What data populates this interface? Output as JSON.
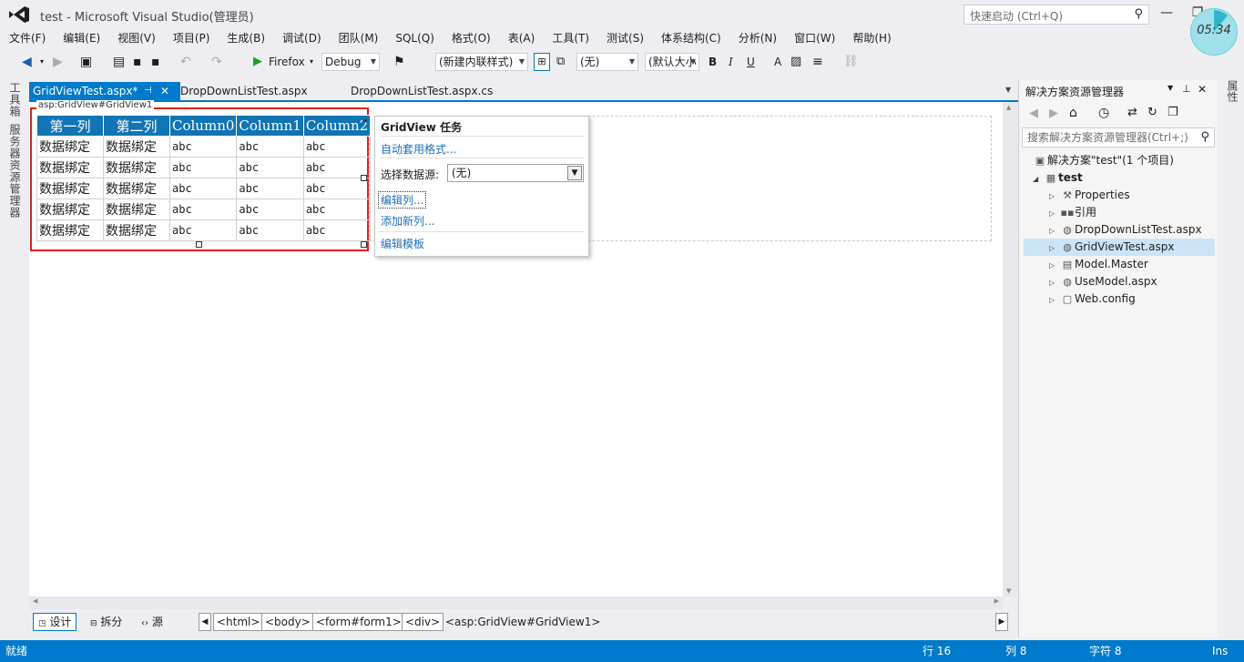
{
  "window": {
    "title": "test - Microsoft Visual Studio(管理员)",
    "quick_launch_placeholder": "快速启动 (Ctrl+Q)",
    "clock": "05:34"
  },
  "menu": [
    "文件(F)",
    "编辑(E)",
    "视图(V)",
    "项目(P)",
    "生成(B)",
    "调试(D)",
    "团队(M)",
    "SQL(Q)",
    "格式(O)",
    "表(A)",
    "工具(T)",
    "测试(S)",
    "体系结构(C)",
    "分析(N)",
    "窗口(W)",
    "帮助(H)"
  ],
  "toolbar": {
    "run_target": "Firefox",
    "config": "Debug",
    "style_combo": "(新建内联样式)",
    "element_combo": "(无)",
    "font_combo": "(默认大小",
    "bold": "B",
    "italic": "I",
    "underline": "U",
    "font_color": "A"
  },
  "left_tabs": [
    "工具箱",
    "服务器资源管理器"
  ],
  "doc_tabs": [
    {
      "label": "GridViewTest.aspx*",
      "active": true
    },
    {
      "label": "DropDownListTest.aspx",
      "active": false
    },
    {
      "label": "DropDownListTest.aspx.cs",
      "active": false
    }
  ],
  "designer": {
    "element_label": "asp:GridView#GridView1",
    "grid": {
      "headers": [
        "第一列",
        "第二列",
        "Column0",
        "Column1",
        "Column2"
      ],
      "rows": [
        [
          "数据绑定",
          "数据绑定",
          "abc",
          "abc",
          "abc"
        ],
        [
          "数据绑定",
          "数据绑定",
          "abc",
          "abc",
          "abc"
        ],
        [
          "数据绑定",
          "数据绑定",
          "abc",
          "abc",
          "abc"
        ],
        [
          "数据绑定",
          "数据绑定",
          "abc",
          "abc",
          "abc"
        ],
        [
          "数据绑定",
          "数据绑定",
          "abc",
          "abc",
          "abc"
        ]
      ]
    },
    "tasks": {
      "title": "GridView 任务",
      "auto_format": "自动套用格式...",
      "datasource_label": "选择数据源:",
      "datasource_value": "(无)",
      "edit_columns": "编辑列...",
      "add_column": "添加新列...",
      "edit_templates": "编辑模板"
    }
  },
  "viewbar": {
    "design": "设计",
    "split": "拆分",
    "source": "源",
    "tags": [
      "<html>",
      "<body>",
      "<form#form1>",
      "<div>"
    ],
    "current": "<asp:GridView#GridView1>"
  },
  "solution_explorer": {
    "title": "解决方案资源管理器",
    "search_placeholder": "搜索解决方案资源管理器(Ctrl+;)",
    "items": [
      {
        "label": "解决方案\"test\"(1 个项目)",
        "level": 0,
        "icon": "solution-icon",
        "glyph": "▣"
      },
      {
        "label": "test",
        "level": 1,
        "icon": "web-project-icon",
        "glyph": "▦",
        "bold": true
      },
      {
        "label": "Properties",
        "level": 2,
        "icon": "wrench-icon",
        "glyph": "🔧"
      },
      {
        "label": "引用",
        "level": 2,
        "icon": "references-icon",
        "glyph": "■"
      },
      {
        "label": "DropDownListTest.aspx",
        "level": 2,
        "icon": "aspx-file-icon",
        "glyph": "◍"
      },
      {
        "label": "GridViewTest.aspx",
        "level": 2,
        "icon": "aspx-file-icon",
        "glyph": "◍",
        "selected": true
      },
      {
        "label": "Model.Master",
        "level": 2,
        "icon": "master-file-icon",
        "glyph": "▤"
      },
      {
        "label": "UseModel.aspx",
        "level": 2,
        "icon": "aspx-file-icon",
        "glyph": "◍"
      },
      {
        "label": "Web.config",
        "level": 2,
        "icon": "config-file-icon",
        "glyph": "▢"
      }
    ]
  },
  "right_tab": "属性",
  "status": {
    "ready": "就绪",
    "line": "行 16",
    "col": "列 8",
    "char": "字符 8",
    "mode": "Ins"
  },
  "colors": {
    "accent": "#007acc",
    "grid_header": "#1175b5",
    "selection_frame": "#e02020"
  }
}
